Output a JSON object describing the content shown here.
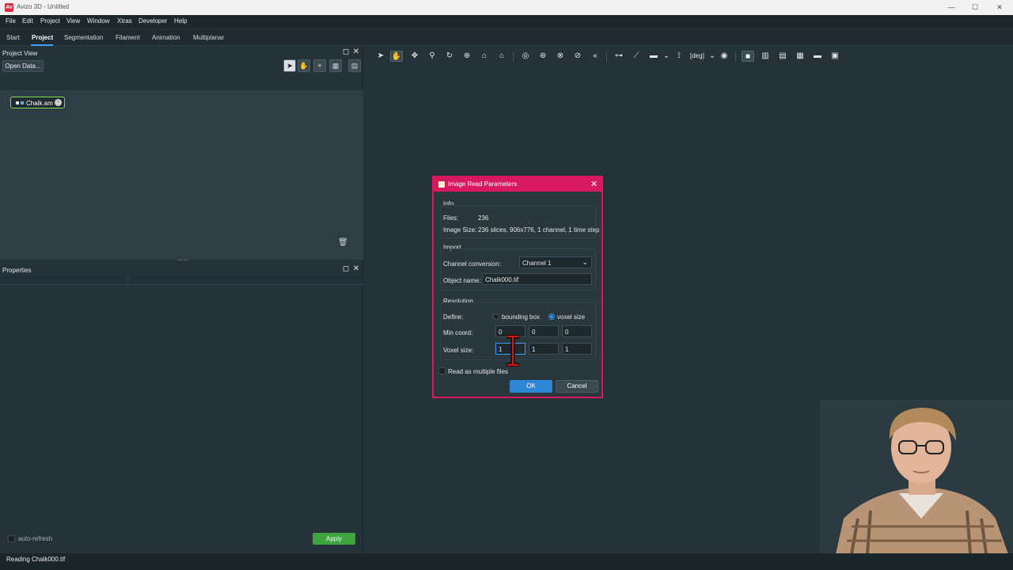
{
  "window": {
    "title": "Avizo 3D - Untitled",
    "app_icon_text": "Av",
    "controls": {
      "minimize": "—",
      "maximize": "☐",
      "close": "✕"
    }
  },
  "menubar": {
    "items": [
      "File",
      "Edit",
      "Project",
      "View",
      "Window",
      "Xtras",
      "Developer",
      "Help"
    ]
  },
  "tabs": {
    "items": [
      "Start",
      "Project",
      "Segmentation",
      "Filament",
      "Animation",
      "Multiplanar"
    ],
    "active": "Project"
  },
  "project_view": {
    "title": "Project View",
    "open_data_label": "Open Data...",
    "data_node_label": "Chalk.am"
  },
  "properties": {
    "title": "Properties",
    "auto_refresh_label": "auto-refresh",
    "apply_label": "Apply"
  },
  "viewer_toolbar": {
    "angle_unit": "[deg]"
  },
  "dialog": {
    "title": "Image Read Parameters",
    "info_label": "Info",
    "files_label": "Files:",
    "files_value": "236",
    "image_size_label": "Image Size:",
    "image_size_value": "236 slices, 906x776, 1 channel, 1 time step",
    "import_label": "Import",
    "channel_conversion_label": "Channel conversion:",
    "channel_conversion_value": "Channel 1",
    "object_name_label": "Object name:",
    "object_name_value": "Chalk000.tif",
    "resolution_label": "Resolution",
    "define_label": "Define:",
    "bounding_box_label": "bounding box",
    "voxel_size_option_label": "voxel size",
    "define_selected": "voxel size",
    "min_coord_label": "Min coord:",
    "min_coord": [
      "0",
      "0",
      "0"
    ],
    "voxel_size_label": "Voxel size:",
    "voxel_size": [
      "1",
      "1",
      "1"
    ],
    "read_multiple_label": "Read as multiple files",
    "ok_label": "OK",
    "cancel_label": "Cancel"
  },
  "statusbar": {
    "text": "Reading Chalk000.tif"
  },
  "colors": {
    "accent": "#d8195f",
    "primary_button": "#2e86d6",
    "apply_button": "#3fa33f",
    "selection_green": "#7ed957",
    "background": "#253238"
  }
}
